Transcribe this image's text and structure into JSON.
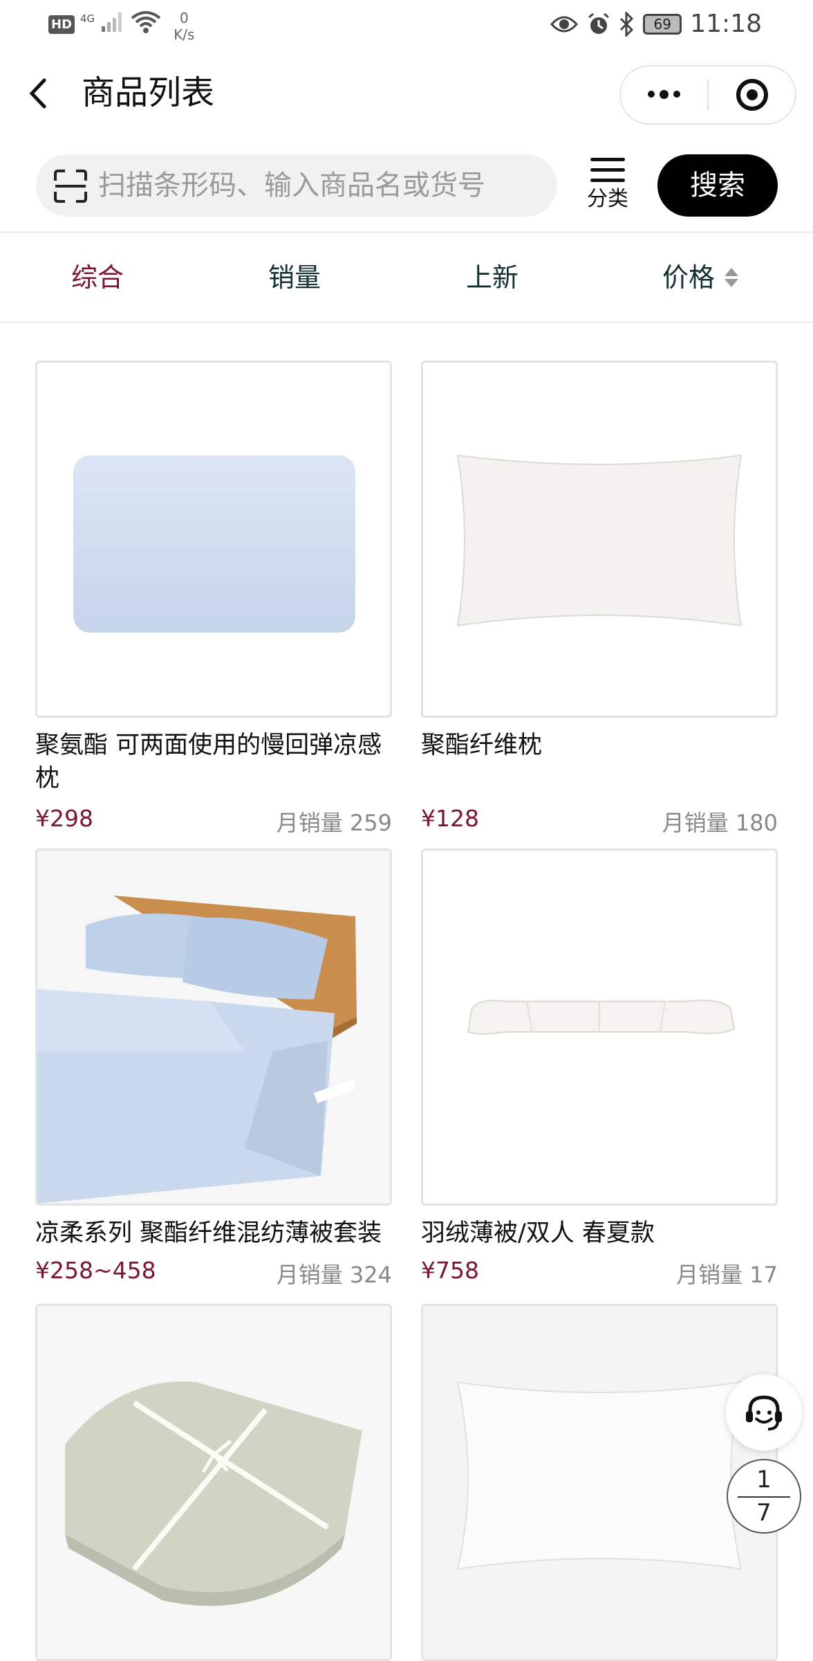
{
  "status_bar": {
    "hd": "HD",
    "network": "4G",
    "speed_value": "0",
    "speed_unit": "K/s",
    "battery": "69",
    "time": "11:18"
  },
  "nav": {
    "title": "商品列表"
  },
  "search": {
    "placeholder": "扫描条形码、输入商品名或货号",
    "category_label": "分类",
    "button_label": "搜索"
  },
  "tabs": [
    {
      "label": "综合",
      "active": true
    },
    {
      "label": "销量",
      "active": false
    },
    {
      "label": "上新",
      "active": false
    },
    {
      "label": "价格",
      "active": false
    }
  ],
  "products": [
    {
      "name": "聚氨酯 可两面使用的慢回弹凉感枕",
      "price": "¥298",
      "sales": "月销量 259",
      "image": "light-blue-memory-foam-pillow"
    },
    {
      "name": "聚酯纤维枕",
      "price": "¥128",
      "sales": "月销量 180",
      "image": "white-polyester-pillow"
    },
    {
      "name": "凉柔系列 聚酯纤维混纺薄被套装",
      "price": "¥258~458",
      "sales": "月销量 324",
      "image": "bed-with-light-blue-bedding"
    },
    {
      "name": "羽绒薄被/双人 春夏款",
      "price": "¥758",
      "sales": "月销量 17",
      "image": "folded-white-down-quilt"
    },
    {
      "name": "",
      "price": "",
      "sales": "",
      "image": "folded-sage-quilt-tied-ribbon"
    },
    {
      "name": "",
      "price": "",
      "sales": "",
      "image": "white-down-pillow"
    }
  ],
  "pager": {
    "current": "1",
    "total": "7"
  },
  "colors": {
    "accent": "#7b1530",
    "tab_text": "#123030",
    "search_button": "#000000"
  }
}
